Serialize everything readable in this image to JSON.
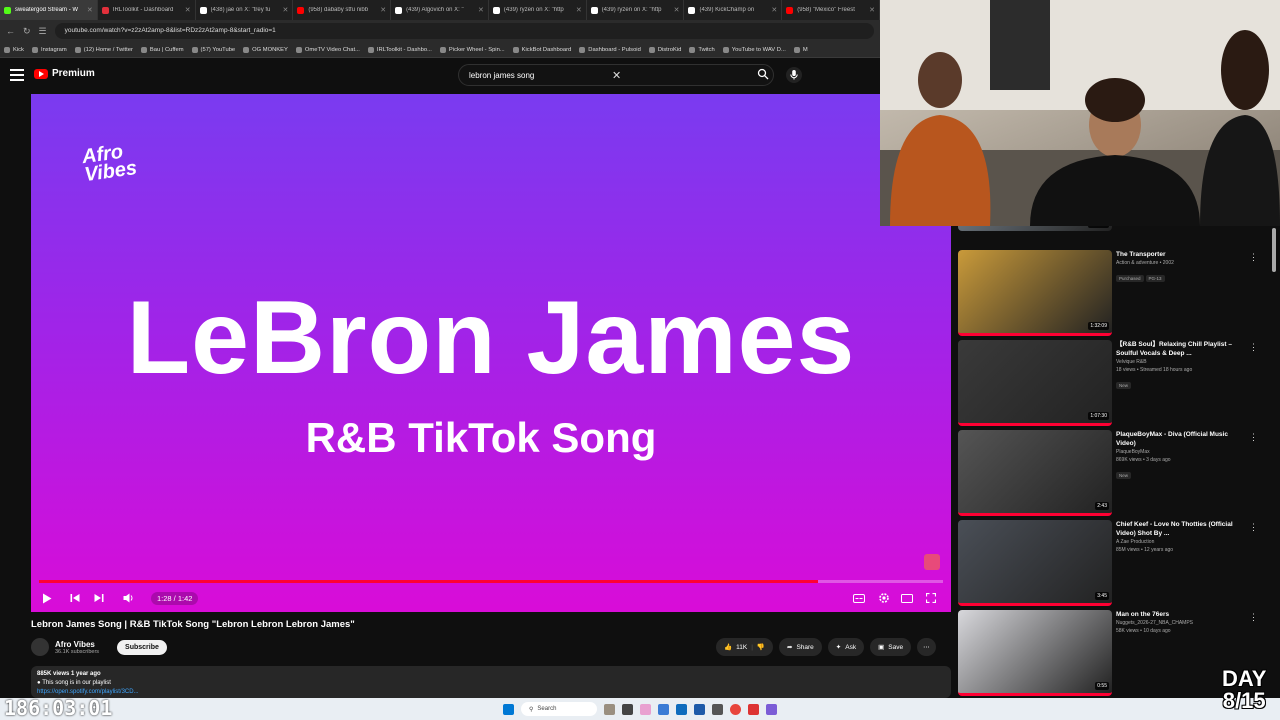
{
  "browser": {
    "tabs": [
      {
        "title": "sweatergod Stream - W",
        "color": "#53fc18"
      },
      {
        "title": "IRLToolkit - Dashboard",
        "color": "#e2303b"
      },
      {
        "title": "(438) jae on X: \"trey fu",
        "color": "#ffffff"
      },
      {
        "title": "(958) dababy stfu nibb",
        "color": "#ff0000"
      },
      {
        "title": "(439) Algovich on X: \"",
        "color": "#ffffff"
      },
      {
        "title": "(439) ryzen on X: \"http",
        "color": "#ffffff"
      },
      {
        "title": "(439) ryzen on X: \"http",
        "color": "#ffffff"
      },
      {
        "title": "(439) KickChamp on",
        "color": "#ffffff"
      },
      {
        "title": "(958) \"Mexico\" Freest",
        "color": "#ff0000"
      }
    ],
    "url": "youtube.com/watch?v=z2zAt2amp-8&list=RDz2zAt2amp-8&start_radio=1",
    "bookmarks": [
      "Kick",
      "Instagram",
      "(12) Home / Twitter",
      "Bau | Cuffem",
      "(57) YouTube",
      "OG MONKEY",
      "OmeTV Video Chat...",
      "IRLToolkit - Dashbo...",
      "Picker Wheel - Spin...",
      "KickBot Dashboard",
      "Dashboard - Pulsoid",
      "DistroKid",
      "Twitch",
      "YouTube to WAV D...",
      "M"
    ]
  },
  "youtube": {
    "brand": "Premium",
    "search_query": "lebron james song"
  },
  "video": {
    "logo_text": "Afro Vibes",
    "big_title": "LeBron James",
    "subtitle": "R&B TikTok Song",
    "time": "1:28 / 1:42",
    "progress": 0.862,
    "title": "Lebron James Song | R&B TikTok Song \"Lebron Lebron Lebron James\"",
    "channel": "Afro Vibes",
    "subscribers": "36.1K subscribers",
    "subscribe_label": "Subscribe",
    "likes": "11K",
    "share_label": "Share",
    "ask_label": "Ask",
    "save_label": "Save",
    "desc_line1": "885K views  1 year ago",
    "desc_line2": "This song is in our playlist",
    "desc_link": "https://open.spotify.com/playlist/3CD..."
  },
  "recommendations": [
    {
      "title": "",
      "meta1": "",
      "meta2": "",
      "duration": "1:53:14",
      "bg": "#8a97a3"
    },
    {
      "title": "The Transporter",
      "meta1": "Action & adventure • 2002",
      "meta2": "",
      "badges": [
        "Purchased",
        "PG-13"
      ],
      "duration": "1:32:09",
      "bg": "#c99a3a"
    },
    {
      "title": "【R&B Soul】Relaxing Chill Playlist – Soulful Vocals & Deep ...",
      "meta1": "Velvique R&B",
      "meta2": "18 views • Streamed 18 hours ago",
      "badges": [
        "New"
      ],
      "duration": "1:07:30",
      "bg": "#3a3a3a"
    },
    {
      "title": "PlaqueBoyMax - Diva (Official Music Video)",
      "meta1": "PlaqueBoyMax",
      "meta2": "869K views • 3 days ago",
      "badges": [
        "New"
      ],
      "duration": "2:43",
      "bg": "#555555"
    },
    {
      "title": "Chief Keef - Love No Thotties (Official Video) Shot By ...",
      "meta1": "A Zae Production",
      "meta2": "85M views • 12 years ago",
      "badges": [],
      "duration": "3:45",
      "bg": "#4a4f57"
    },
    {
      "title": "Man on the 76ers",
      "meta1": "Nuggets_2026-27_NBA_CHAMPS",
      "meta2": "58K views • 10 days ago",
      "badges": [],
      "duration": "0:55",
      "bg": "#d8d8dc"
    }
  ],
  "overlay": {
    "timer": "186:03:01",
    "day_label": "DAY",
    "day_count": "8/15"
  },
  "taskbar": {
    "search_label": "Search"
  },
  "colors": {
    "accent": "#ff0033",
    "video_top": "#7a3bf0",
    "video_bottom": "#d90cd8"
  }
}
